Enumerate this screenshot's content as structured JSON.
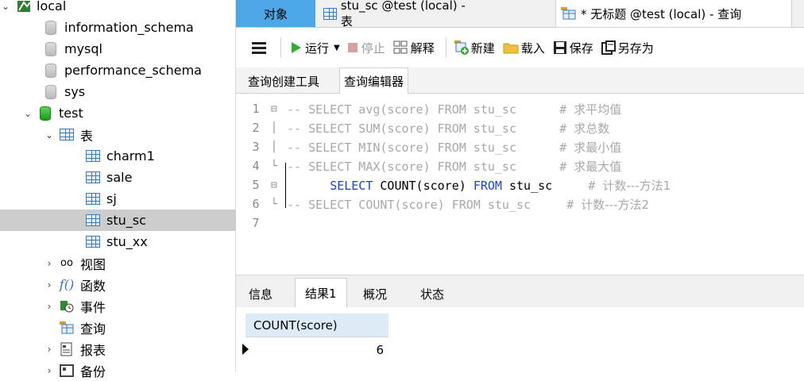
{
  "sidebar": {
    "connection": "local",
    "databases": [
      "information_schema",
      "mysql",
      "performance_schema",
      "sys"
    ],
    "active_db": "test",
    "tables_folder": "表",
    "tables": [
      "charm1",
      "sale",
      "sj",
      "stu_sc",
      "stu_xx"
    ],
    "selected_table": "stu_sc",
    "folders": [
      "视图",
      "函数",
      "事件",
      "查询",
      "报表",
      "备份"
    ]
  },
  "tabs": {
    "objects": "对象",
    "table_tab": "stu_sc @test (local) - 表",
    "query_tab": "* 无标题 @test (local) - 查询"
  },
  "toolbar": {
    "run": "运行",
    "stop": "停止",
    "explain": "解释",
    "new": "新建",
    "load": "载入",
    "save": "保存",
    "save_as": "另存为"
  },
  "subtabs": {
    "builder": "查询创建工具",
    "editor": "查询编辑器"
  },
  "editor": {
    "lines": [
      {
        "n": "1",
        "fold": "⊟",
        "code": "-- SELECT avg(score) FROM stu_sc      # ",
        "cn": "求平均值",
        "active": false
      },
      {
        "n": "2",
        "fold": "│",
        "code": "-- SELECT SUM(score) FROM stu_sc      # ",
        "cn": "求总数",
        "active": false
      },
      {
        "n": "3",
        "fold": "│",
        "code": "-- SELECT MIN(score) FROM stu_sc      # ",
        "cn": "求最小值",
        "active": false
      },
      {
        "n": "4",
        "fold": "└",
        "code": "-- SELECT MAX(score) FROM stu_sc      # ",
        "cn": "求最大值",
        "active": false
      },
      {
        "n": "5",
        "fold": "⊟",
        "code": "",
        "cn": "",
        "active": true
      },
      {
        "n": "6",
        "fold": "└",
        "code": "-- SELECT COUNT(score) FROM stu_sc     # ",
        "cn": "计数---方法2",
        "active": false
      },
      {
        "n": "7",
        "fold": "",
        "code": "",
        "cn": "",
        "active": false
      }
    ],
    "line5": {
      "kw1": "SELECT",
      "fn": " COUNT(score) ",
      "kw2": "FROM",
      "tbl": " stu_sc",
      "comment": "     # ",
      "cn": "计数---方法1"
    }
  },
  "results": {
    "tabs": [
      "信息",
      "结果1",
      "概况",
      "状态"
    ],
    "column": "COUNT(score)",
    "value": "6"
  },
  "colors": {
    "objects_tab": "#4ea8e8",
    "keyword": "#1a3fd6",
    "comment": "#a8a8a8",
    "selected_row": "#cccccc"
  }
}
